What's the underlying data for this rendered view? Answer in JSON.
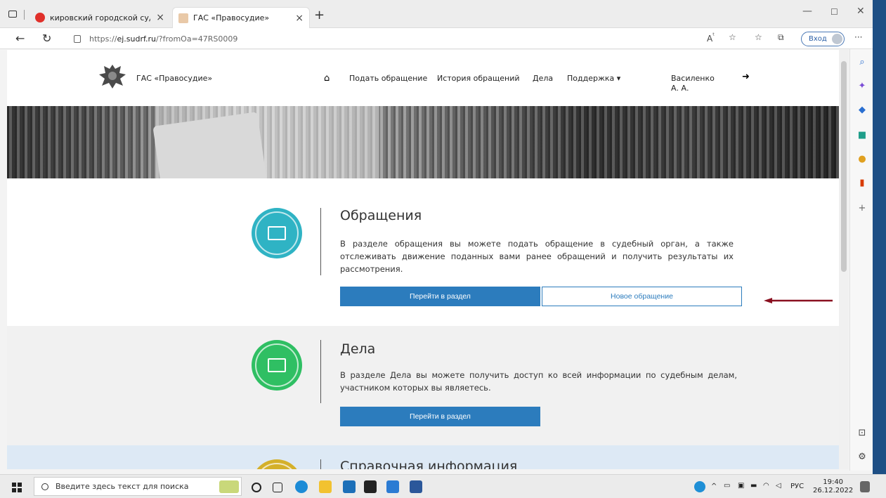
{
  "browser": {
    "tabs": [
      {
        "label": "кировский городской суд ленин",
        "active": false
      },
      {
        "label": "ГАС «Правосудие»",
        "active": true
      }
    ],
    "url_prefix": "https://",
    "url_host": "ej.sudrf.ru",
    "url_path": "/?fromOa=47RS0009",
    "login_label": "Вход"
  },
  "header": {
    "site_name": "ГАС «Правосудие»",
    "nav": [
      {
        "label": "Подать обращение"
      },
      {
        "label": "История обращений"
      },
      {
        "label": "Дела"
      },
      {
        "label": "Поддержка ▾"
      }
    ],
    "user_name": "Василенко А. А."
  },
  "sections": {
    "appeals": {
      "title": "Обращения",
      "text": "В разделе обращения вы можете подать обращение в судебный орган, а также отслеживать движение поданных вами ранее обращений и получить результаты их рассмотрения.",
      "primary_btn": "Перейти в раздел",
      "secondary_btn": "Новое обращение",
      "color": "#2fb3c4"
    },
    "cases": {
      "title": "Дела",
      "text": "В разделе Дела вы можете получить доступ ко всей информации по судебным делам, участником которых вы являетесь.",
      "primary_btn": "Перейти в раздел",
      "color": "#2fbf63"
    },
    "info": {
      "title": "Справочная информация",
      "color": "#d4b02a"
    }
  },
  "taskbar": {
    "search_placeholder": "Введите здесь текст для поиска",
    "lang": "РУС",
    "time": "19:40",
    "date": "26.12.2022"
  }
}
